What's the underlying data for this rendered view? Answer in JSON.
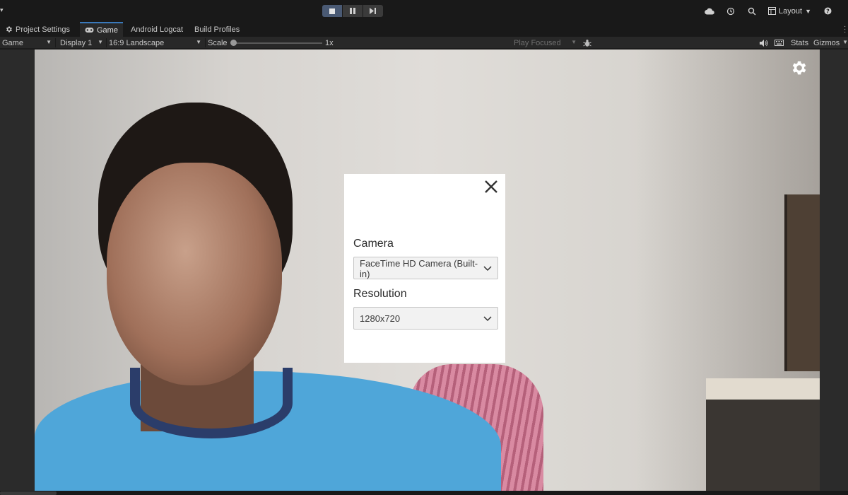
{
  "toolbar": {
    "layout_label": "Layout",
    "icons": [
      "cloud-icon",
      "history-icon",
      "search-icon",
      "layout-icon",
      "help-icon"
    ]
  },
  "tabs": [
    {
      "label": "Project Settings",
      "icon": "gear-icon",
      "active": false
    },
    {
      "label": "Game",
      "icon": "gamepad-icon",
      "active": true
    },
    {
      "label": "Android Logcat",
      "active": false
    },
    {
      "label": "Build Profiles",
      "active": false
    }
  ],
  "gamebar": {
    "view_mode": "Game",
    "display": "Display 1",
    "aspect": "16:9 Landscape",
    "scale_label": "Scale",
    "scale_value": "1x",
    "play_mode": "Play Focused",
    "stats_label": "Stats",
    "gizmos_label": "Gizmos"
  },
  "modal": {
    "camera_label": "Camera",
    "camera_value": "FaceTime HD Camera (Built-in)",
    "resolution_label": "Resolution",
    "resolution_value": "1280x720"
  },
  "colors": {
    "accent": "#3a79bb",
    "play_active": "#4a5a74",
    "shirt": "#4fa6d9"
  }
}
